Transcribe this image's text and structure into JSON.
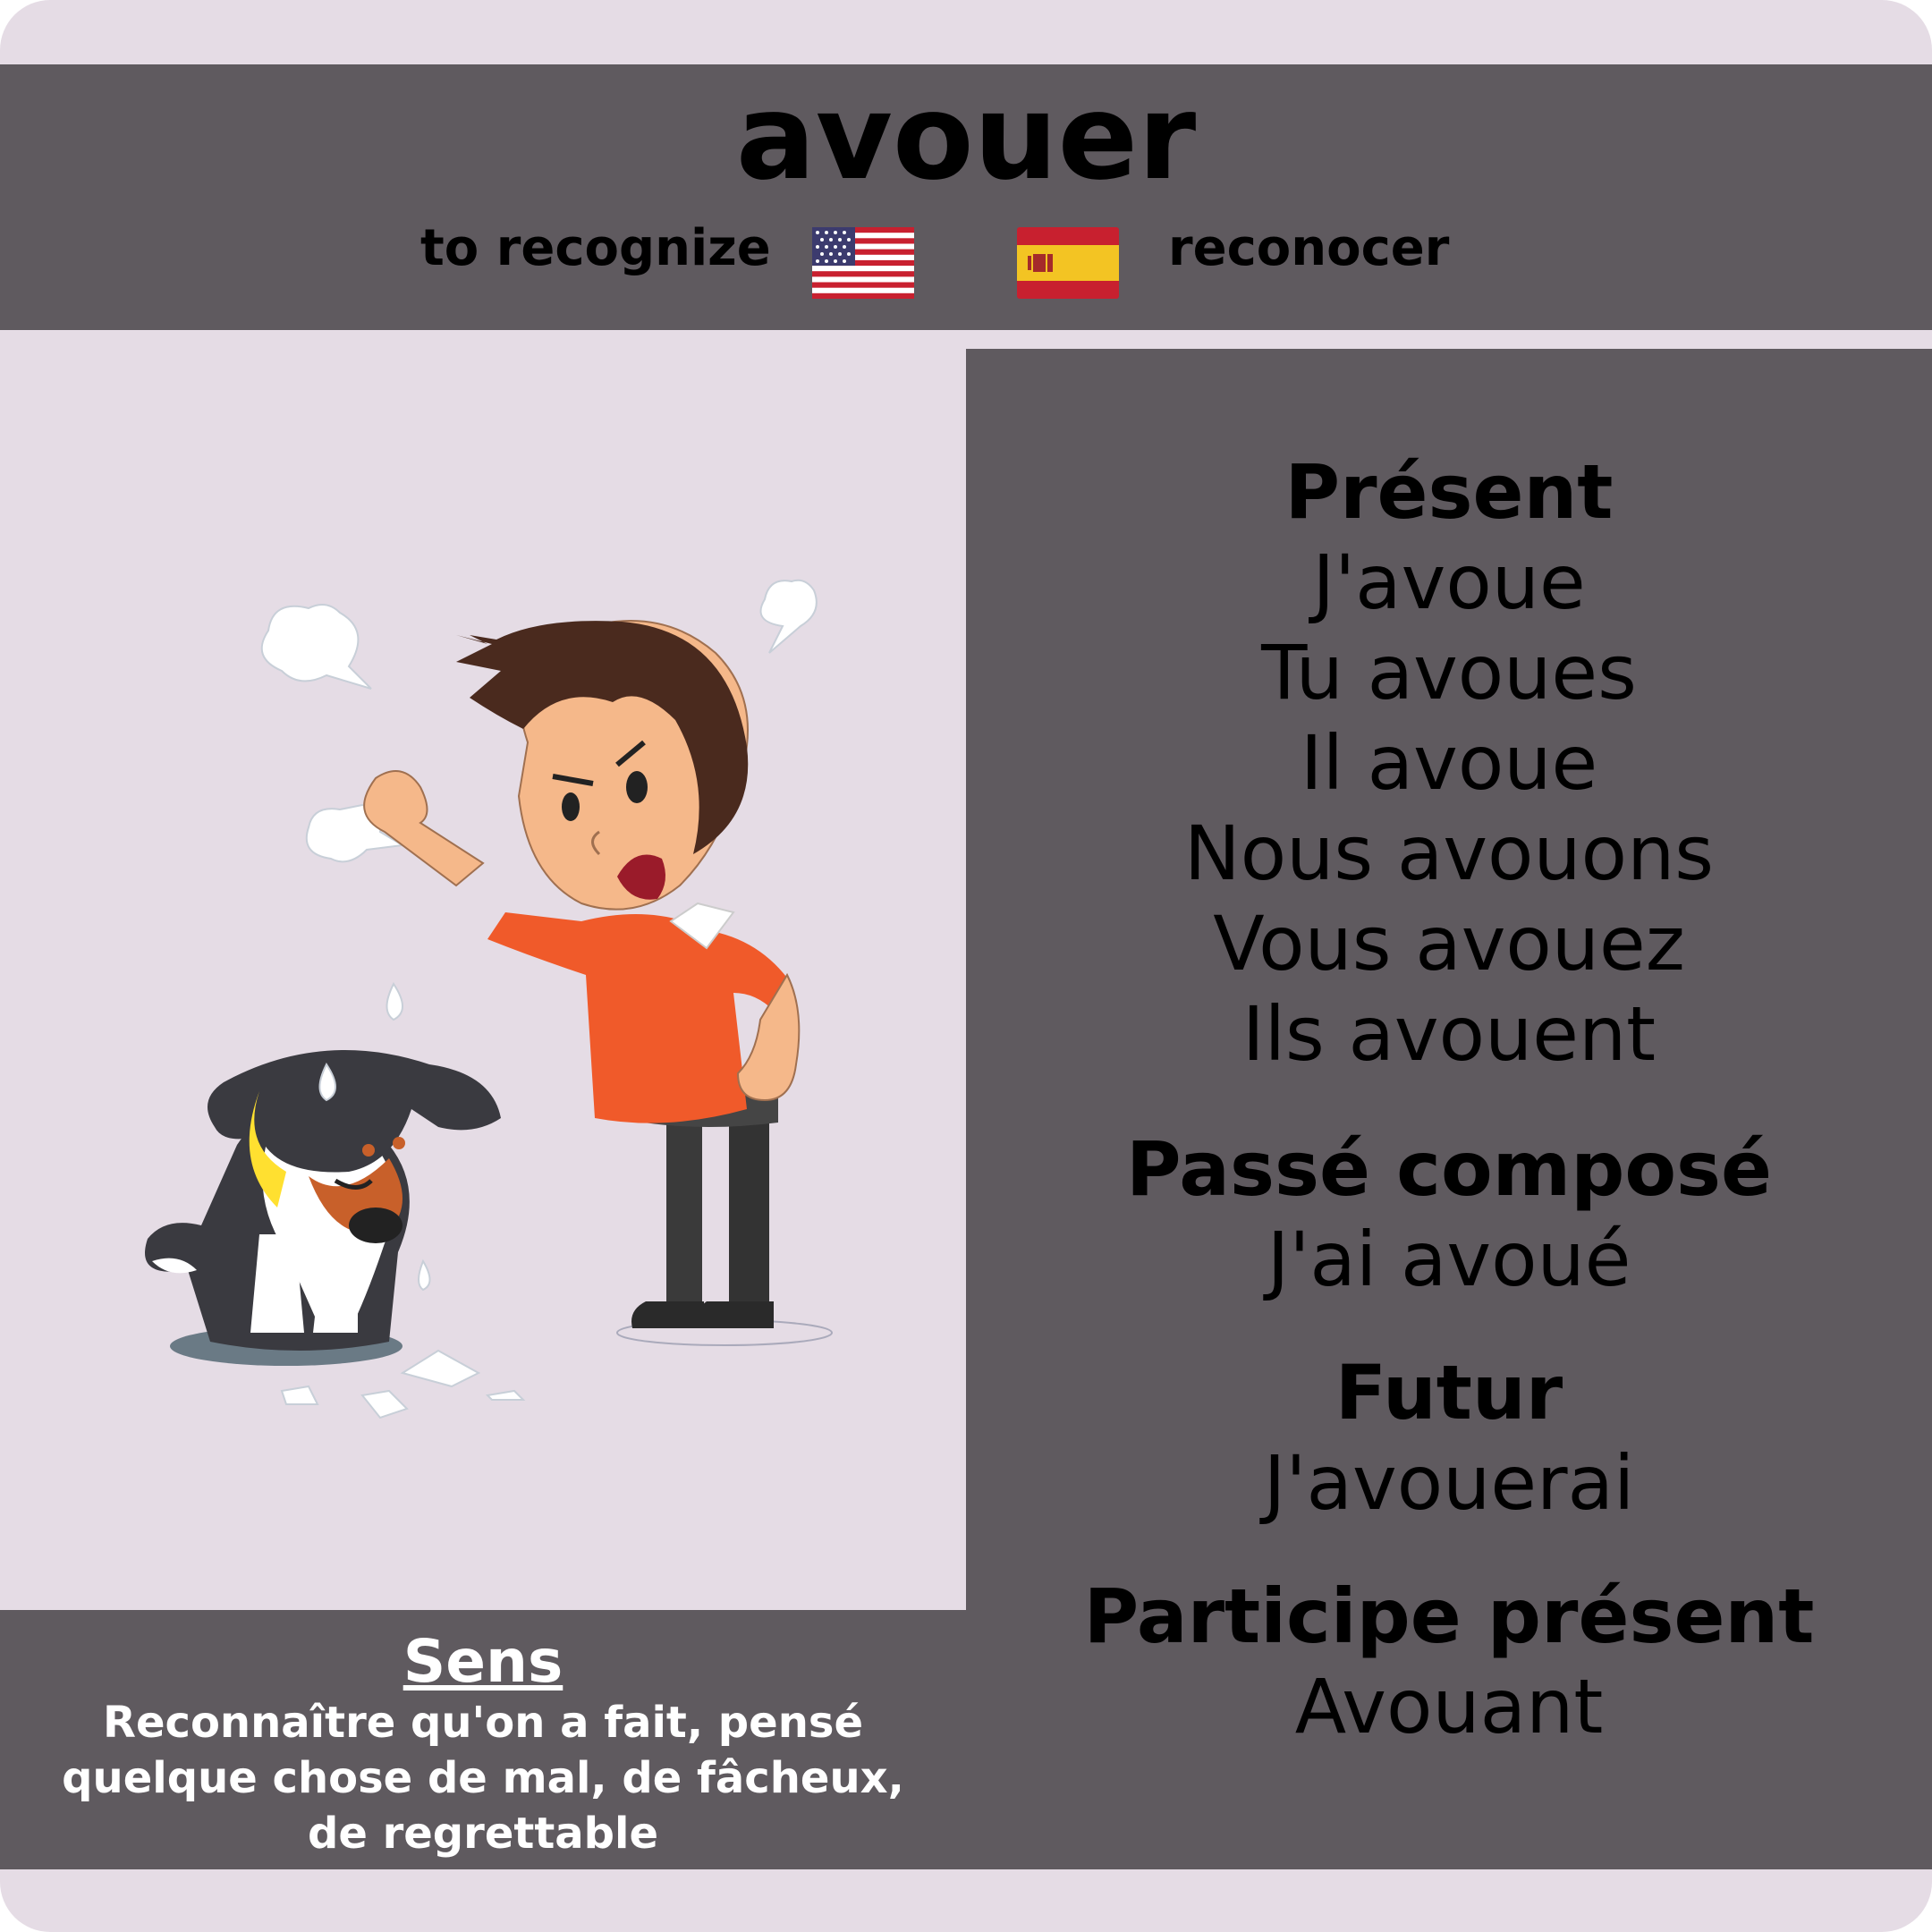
{
  "verb": "avouer",
  "translations": {
    "english": "to recognize",
    "spanish": "reconocer"
  },
  "flags": {
    "us": "us-flag-icon",
    "es": "spain-flag-icon"
  },
  "colors": {
    "panel": "#5f5a5f",
    "background": "#e5dce5",
    "text": "#ffffff"
  },
  "conjugation": {
    "present": {
      "label": "Présent",
      "forms": [
        "J'avoue",
        "Tu avoues",
        "Il avoue",
        "Nous avouons",
        "Vous avouez",
        "Ils avouent"
      ]
    },
    "passe_compose": {
      "label": "Passé composé",
      "form": "J'ai avoué"
    },
    "futur": {
      "label": "Futur",
      "form": "J'avouerai"
    },
    "participe_present": {
      "label": "Participe présent",
      "form": "Avouant"
    }
  },
  "meaning": {
    "label": "Sens",
    "text": "Reconnaître qu'on a fait, pensé quelque chose de mal, de fâcheux, de regrettable"
  },
  "illustration": "angry-man-scolding-dog-illustration"
}
